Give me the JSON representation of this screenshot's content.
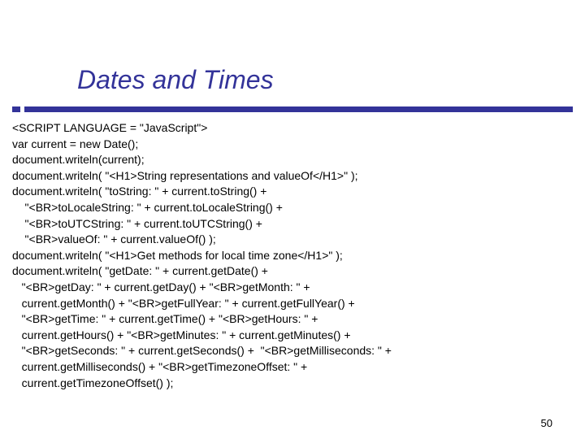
{
  "title": "Dates and Times",
  "page_number": "50",
  "code_lines": [
    "<SCRIPT LANGUAGE = \"JavaScript\">",
    "var current = new Date();",
    "document.writeln(current);",
    "document.writeln( \"<H1>String representations and valueOf</H1>\" );",
    "document.writeln( \"toString: \" + current.toString() +",
    "    \"<BR>toLocaleString: \" + current.toLocaleString() +",
    "    \"<BR>toUTCString: \" + current.toUTCString() +",
    "    \"<BR>valueOf: \" + current.valueOf() );",
    "document.writeln( \"<H1>Get methods for local time zone</H1>\" );",
    "document.writeln( \"getDate: \" + current.getDate() +",
    "   \"<BR>getDay: \" + current.getDay() + \"<BR>getMonth: \" +",
    "   current.getMonth() + \"<BR>getFullYear: \" + current.getFullYear() +",
    "   \"<BR>getTime: \" + current.getTime() + \"<BR>getHours: \" +",
    "   current.getHours() + \"<BR>getMinutes: \" + current.getMinutes() +",
    "   \"<BR>getSeconds: \" + current.getSeconds() +  \"<BR>getMilliseconds: \" +",
    "   current.getMilliseconds() + \"<BR>getTimezoneOffset: \" +",
    "   current.getTimezoneOffset() );"
  ]
}
